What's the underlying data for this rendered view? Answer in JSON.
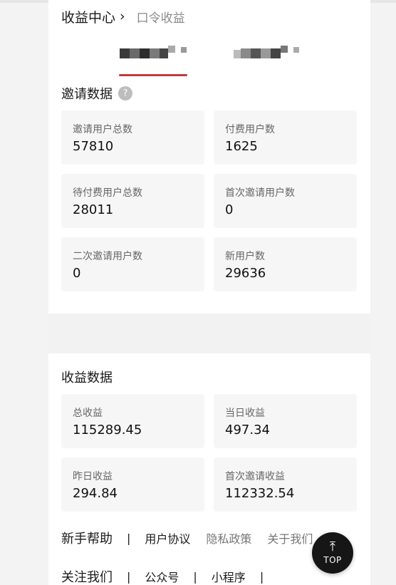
{
  "header": {
    "title": "收益中心",
    "chevron": "›",
    "subtitle": "口令收益"
  },
  "invite_section": {
    "title": "邀请数据",
    "help_icon": "?",
    "cards": [
      {
        "label": "邀请用户总数",
        "value": "57810"
      },
      {
        "label": "付费用户数",
        "value": "1625"
      },
      {
        "label": "待付费用户总数",
        "value": "28011"
      },
      {
        "label": "首次邀请用户数",
        "value": "0"
      },
      {
        "label": "二次邀请用户数",
        "value": "0"
      },
      {
        "label": "新用户数",
        "value": "29636"
      }
    ]
  },
  "income_section": {
    "title": "收益数据",
    "cards": [
      {
        "label": "总收益",
        "value": "115289.45"
      },
      {
        "label": "当日收益",
        "value": "497.34"
      },
      {
        "label": "昨日收益",
        "value": "294.84"
      },
      {
        "label": "首次邀请收益",
        "value": "112332.54"
      }
    ]
  },
  "footer": {
    "row1": {
      "help": "新手帮助",
      "sep": "|",
      "agreement": "用户协议",
      "privacy": "隐私政策",
      "about": "关于我们"
    },
    "row2": {
      "follow": "关注我们",
      "sep": "|",
      "official": "公众号",
      "mini": "小程序"
    }
  },
  "top_button": {
    "arrow": "⤒",
    "label": "TOP"
  },
  "colors": {
    "accent": "#c33a3a",
    "card_bg": "#f6f6f7",
    "top_button_bg": "#161616"
  }
}
